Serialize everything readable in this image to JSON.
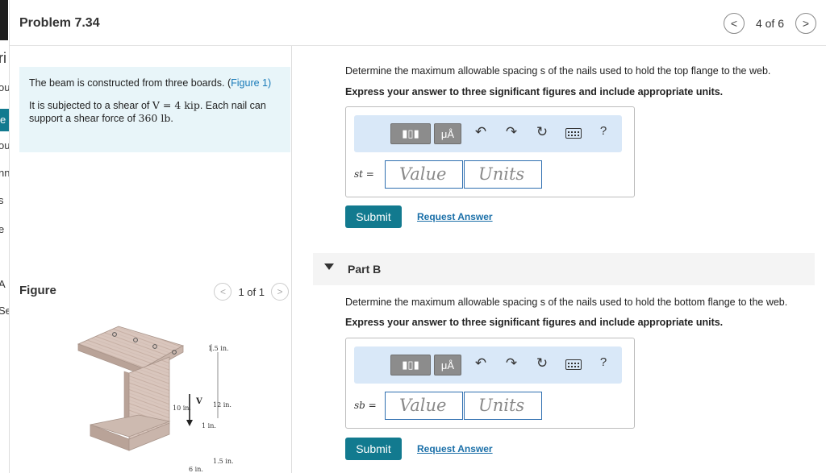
{
  "peek": {
    "letters": [
      "ri",
      "ou",
      "e",
      "ou",
      "nn",
      "s",
      "e",
      "A",
      "Se"
    ]
  },
  "header": {
    "title": "Problem 7.34",
    "page": "4 of 6",
    "prev": "<",
    "next": ">"
  },
  "statement": {
    "line1_text": "The beam is constructed from three boards. (",
    "line1_link": "Figure 1",
    "line1_close": ")",
    "line2_pre": "It is subjected to a shear of ",
    "line2_math": "V = 4 kip",
    "line2_mid": ". Each nail can support a shear force of ",
    "line2_math2": "360 lb",
    "line2_end": "."
  },
  "figure": {
    "label": "Figure",
    "page": "1 of 1",
    "prev": "<",
    "next": ">",
    "dims": {
      "top": "1.5 in.",
      "flange": "10 in.",
      "web_h": "12 in.",
      "web_t": "1 in.",
      "bottom": "1.5 in.",
      "bottom_w": "6 in.",
      "shear": "V"
    }
  },
  "partA": {
    "question": "Determine the maximum allowable spacing s of the nails used to hold the top flange to the web.",
    "instructions": "Express your answer to three significant figures and include appropriate units.",
    "var": "st =",
    "value_placeholder": "Value",
    "units_placeholder": "Units",
    "submit": "Submit",
    "request": "Request Answer"
  },
  "partB": {
    "header": "Part B",
    "question": "Determine the maximum allowable spacing s of the nails used to hold the bottom flange to the web.",
    "instructions": "Express your answer to three significant figures and include appropriate units.",
    "var": "sb =",
    "value_placeholder": "Value",
    "units_placeholder": "Units",
    "submit": "Submit",
    "request": "Request Answer"
  },
  "toolbar": {
    "mu": "μÅ",
    "help": "?"
  }
}
